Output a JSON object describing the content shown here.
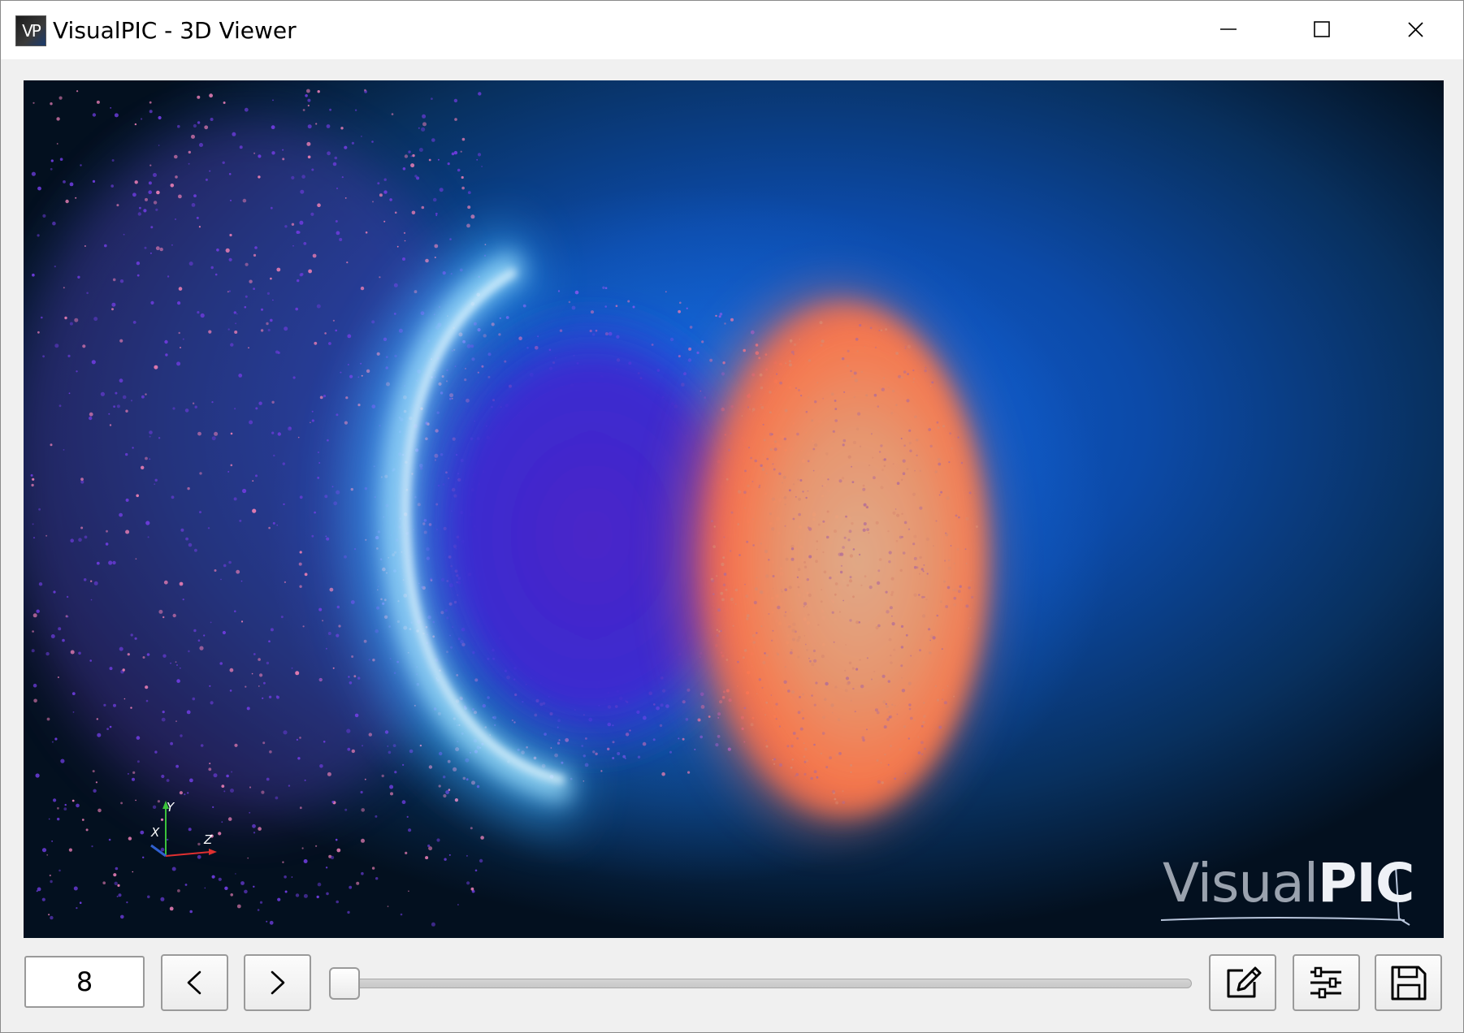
{
  "window": {
    "title": "VisualPIC - 3D Viewer",
    "app_icon_text": "VP"
  },
  "viewport": {
    "watermark_light": "Visual",
    "watermark_bold": "PIC",
    "axes": {
      "x_label": "X",
      "y_label": "Y",
      "z_label": "Z"
    },
    "colors": {
      "background_center": "#1060d8",
      "background_edge": "#03101f",
      "ring": "#7fdcff",
      "particles_violet": "#6a3bd8",
      "particles_pink": "#e07ab0",
      "bunch_orange": "#ff8a4a"
    }
  },
  "controls": {
    "frame_value": "8",
    "prev_icon": "chevron-left-icon",
    "next_icon": "chevron-right-icon",
    "slider_position": 0,
    "edit_icon": "edit-icon",
    "settings_icon": "sliders-icon",
    "save_icon": "save-icon"
  }
}
